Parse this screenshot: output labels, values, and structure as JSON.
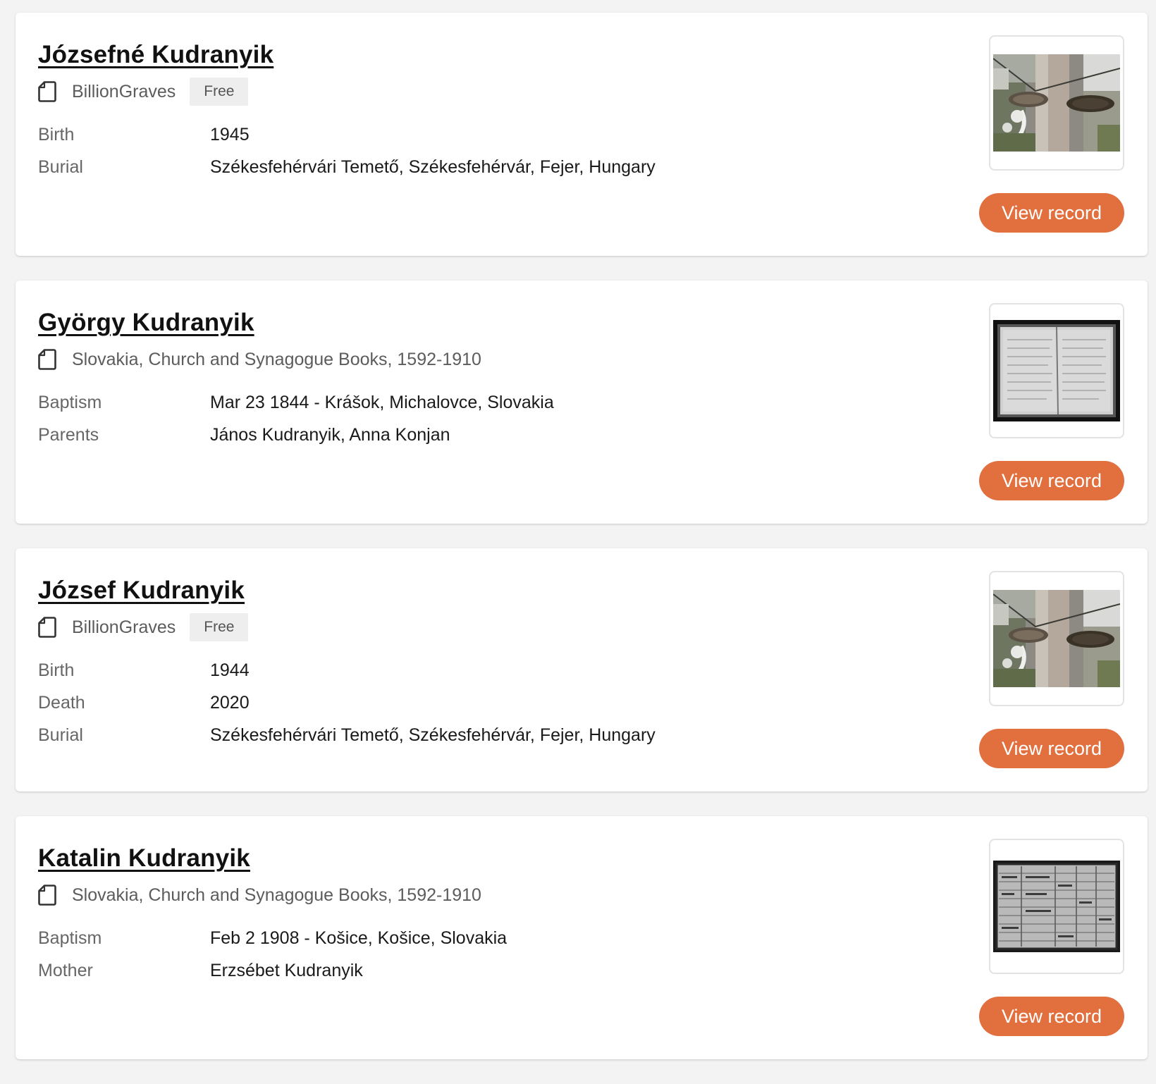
{
  "brand": {
    "accent_color": "#e2703f",
    "page_background": "#f3f3f3"
  },
  "records": [
    {
      "name": "Józsefné Kudranyik",
      "source": "BillionGraves",
      "badge": "Free",
      "source_icon": "document-icon",
      "thumbnail": "gravestone-photo",
      "facts": [
        {
          "label": "Birth",
          "value": "1945"
        },
        {
          "label": "Burial",
          "value": "Székesfehérvári Temető, Székesfehérvár, Fejer, Hungary"
        }
      ],
      "button_label": "View record"
    },
    {
      "name": "György Kudranyik",
      "source": "Slovakia, Church and Synagogue Books, 1592-1910",
      "badge": null,
      "source_icon": "document-icon",
      "thumbnail": "church-book-scan",
      "facts": [
        {
          "label": "Baptism",
          "value": "Mar 23 1844 - Krášok, Michalovce, Slovakia"
        },
        {
          "label": "Parents",
          "value": "János Kudranyik, Anna Konjan"
        }
      ],
      "button_label": "View record"
    },
    {
      "name": "József Kudranyik",
      "source": "BillionGraves",
      "badge": "Free",
      "source_icon": "document-icon",
      "thumbnail": "gravestone-photo",
      "facts": [
        {
          "label": "Birth",
          "value": "1944"
        },
        {
          "label": "Death",
          "value": "2020"
        },
        {
          "label": "Burial",
          "value": "Székesfehérvári Temető, Székesfehérvár, Fejer, Hungary"
        }
      ],
      "button_label": "View record"
    },
    {
      "name": "Katalin Kudranyik",
      "source": "Slovakia, Church and Synagogue Books, 1592-1910",
      "badge": null,
      "source_icon": "document-icon",
      "thumbnail": "register-page-scan",
      "facts": [
        {
          "label": "Baptism",
          "value": "Feb 2 1908 - Košice, Košice, Slovakia"
        },
        {
          "label": "Mother",
          "value": "Erzsébet Kudranyik"
        }
      ],
      "button_label": "View record"
    }
  ]
}
